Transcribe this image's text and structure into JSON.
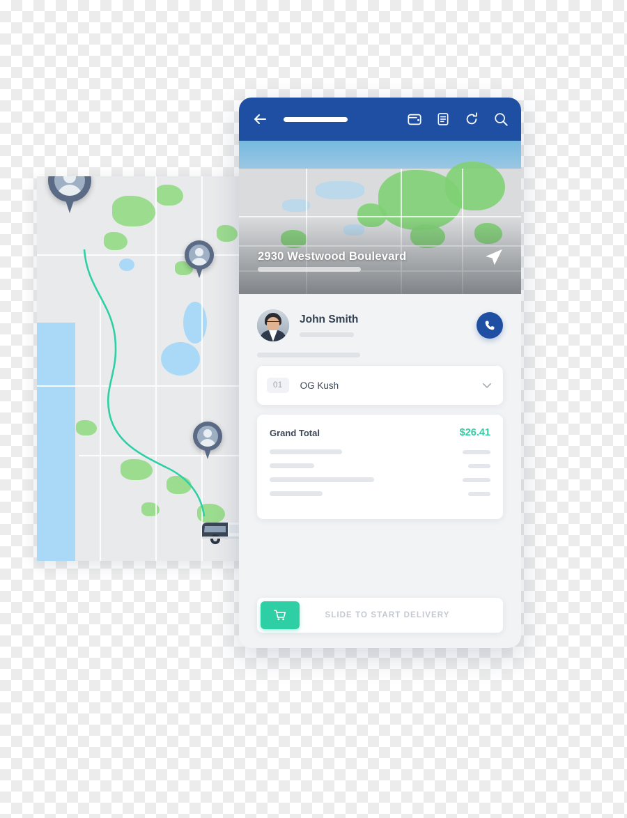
{
  "topbar": {
    "back_icon": "arrow-left-icon",
    "title_placeholder_bar": "",
    "icons": [
      {
        "name": "wallet-icon",
        "label": "Wallet"
      },
      {
        "name": "document-icon",
        "label": "Orders"
      },
      {
        "name": "refresh-icon",
        "label": "Refresh"
      },
      {
        "name": "search-icon",
        "label": "Search"
      }
    ]
  },
  "map_hero": {
    "address": "2930 Westwood Boulevard",
    "send_icon": "send-icon"
  },
  "driver": {
    "name": "John Smith",
    "avatar_name": "driver-avatar",
    "call_icon": "phone-icon"
  },
  "order_item": {
    "quantity": "01",
    "name": "OG Kush",
    "chevron_icon": "chevron-down-icon"
  },
  "totals": {
    "label": "Grand Total",
    "value": "$26.41"
  },
  "slide_action": {
    "label": "SLIDE TO START DELIVERY",
    "knob_icon": "cart-icon"
  },
  "map_card": {
    "pins": [
      {
        "name": "map-pin-pickup"
      },
      {
        "name": "map-pin-waypoint"
      },
      {
        "name": "map-pin-destination"
      }
    ],
    "vehicle": "delivery-van-icon",
    "route_color": "#2ecfa4"
  },
  "colors": {
    "brand_blue": "#1f4fa3",
    "accent_green": "#2ecfa4",
    "text_dark": "#33404f",
    "muted": "#c3c9d0"
  }
}
